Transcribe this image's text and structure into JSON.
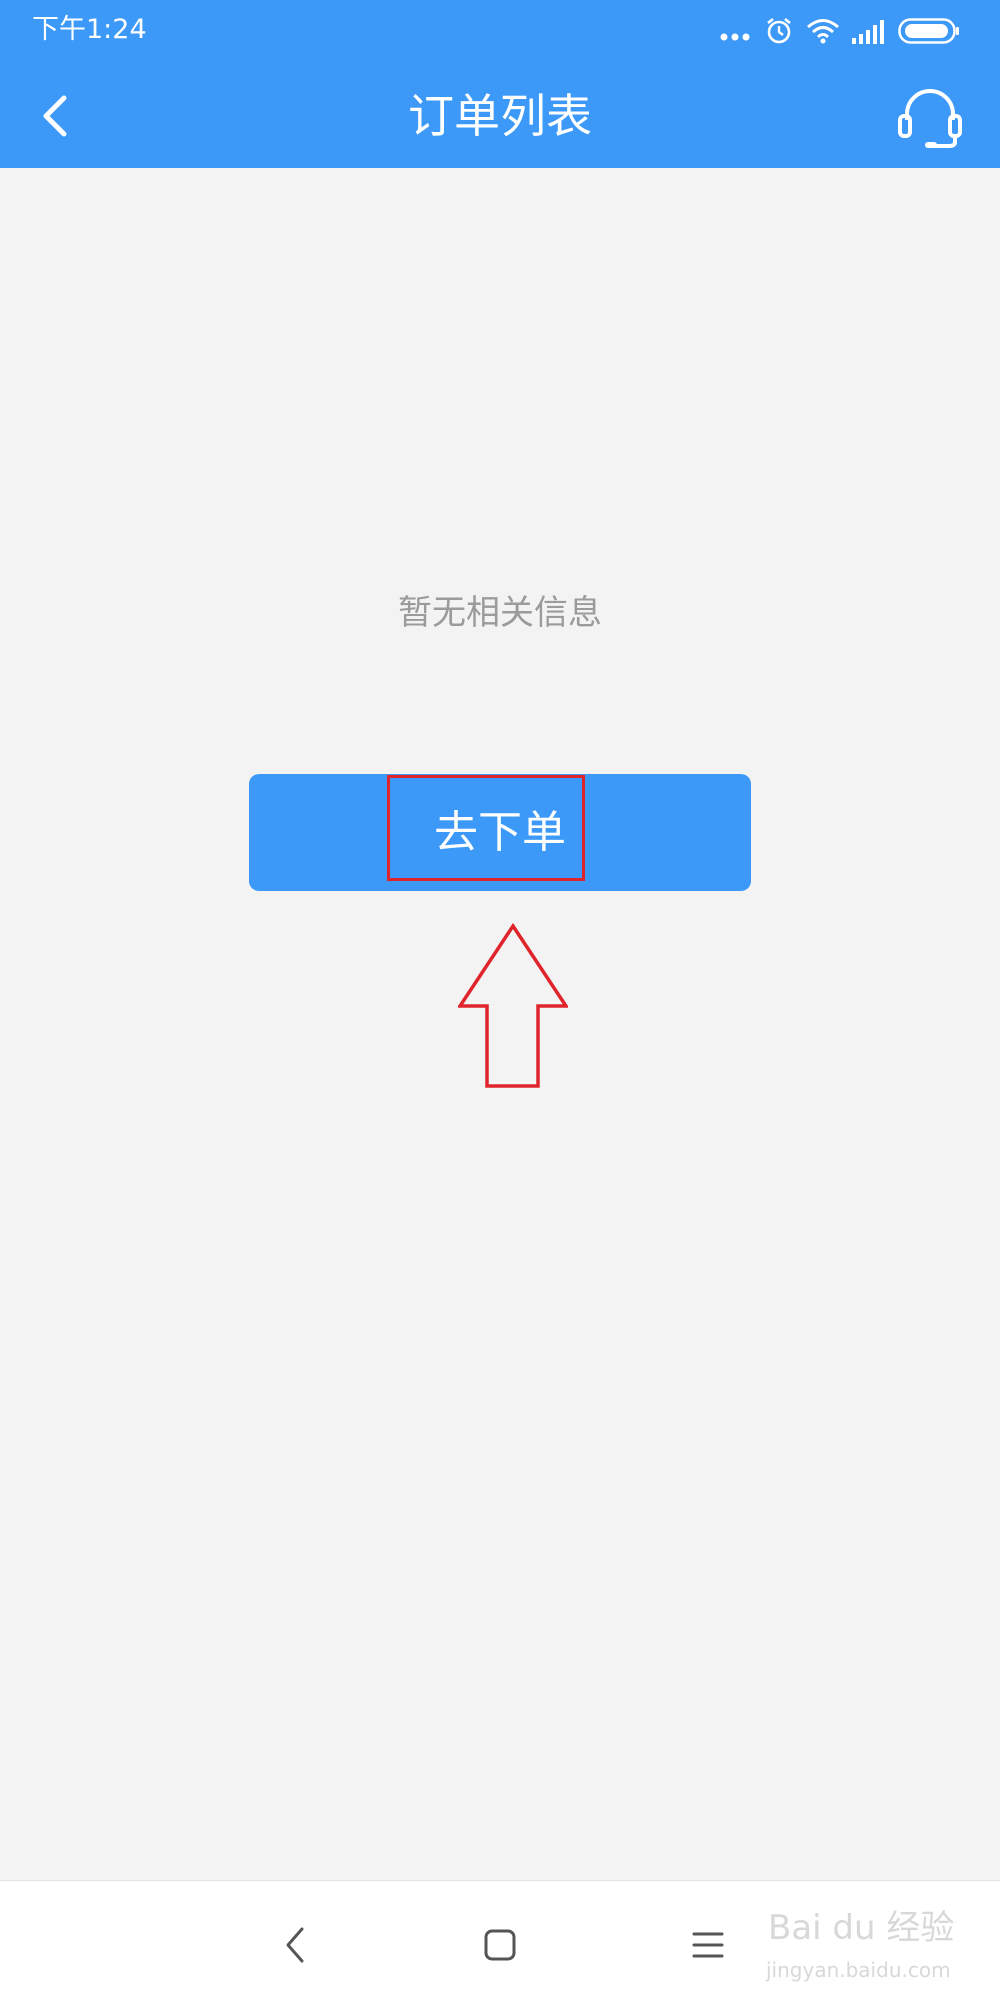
{
  "status_bar": {
    "time": "下午1:24",
    "icons": [
      "more-dots-icon",
      "alarm-icon",
      "wifi-icon",
      "signal-icon",
      "battery-icon"
    ]
  },
  "header": {
    "title": "订单列表",
    "back_icon": "back-arrow-icon",
    "service_icon": "headset-icon"
  },
  "main": {
    "empty_text": "暂无相关信息",
    "order_button_label": "去下单"
  },
  "annotation": {
    "highlight_color": "#e0242c",
    "arrow_icon": "up-arrow-icon"
  },
  "navbar": {
    "items": [
      "nav-back-icon",
      "nav-home-icon",
      "nav-menu-icon"
    ]
  },
  "watermark": {
    "main": "Bai du 经验",
    "sub": "jingyan.baidu.com"
  },
  "colors": {
    "brand": "#3d99f8",
    "background": "#f3f3f3",
    "empty_text": "#9b9b9b"
  }
}
